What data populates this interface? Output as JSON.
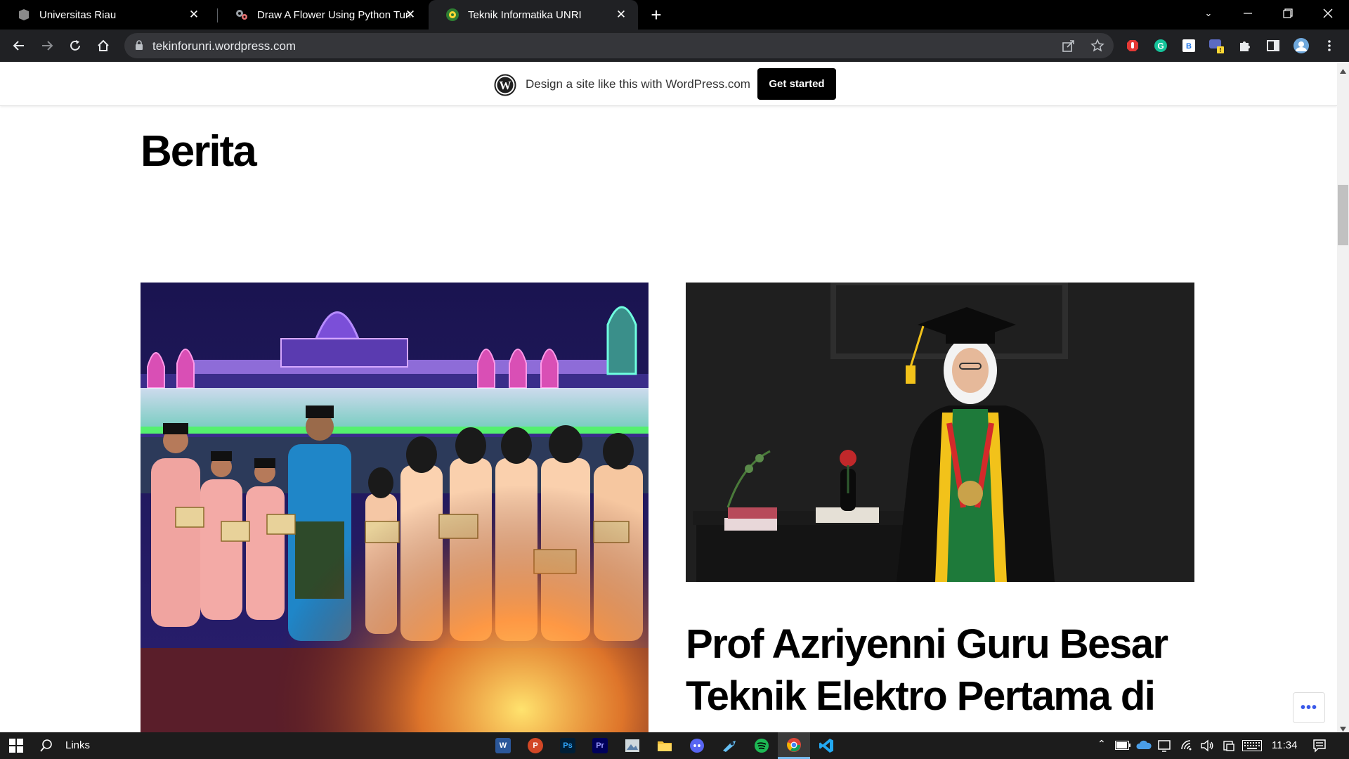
{
  "browser": {
    "tabs": [
      {
        "title": "Universitas Riau",
        "favicon": "shield-icon",
        "active": false
      },
      {
        "title": "Draw A Flower Using Python Turtle",
        "favicon": "gears-icon",
        "active": false
      },
      {
        "title": "Teknik Informatika UNRI",
        "favicon": "unri-logo-icon",
        "active": true
      }
    ],
    "new_tab_label": "+",
    "url": "tekinforunri.wordpress.com"
  },
  "wp_banner": {
    "text": "Design a site like this with WordPress.com",
    "cta": "Get started"
  },
  "page": {
    "title": "Berita",
    "post_title": "Prof Azriyenni Guru Besar Teknik Elektro Pertama di",
    "more_button": "•••"
  },
  "taskbar": {
    "search_label": "Links",
    "clock": "11:34",
    "apps": [
      {
        "name": "word",
        "label": "W",
        "color": "#2b579a"
      },
      {
        "name": "powerpoint",
        "label": "P",
        "color": "#d24726"
      },
      {
        "name": "photoshop",
        "label": "Ps",
        "color": "#001e36"
      },
      {
        "name": "premiere",
        "label": "Pr",
        "color": "#00005b"
      },
      {
        "name": "photos",
        "label": "",
        "color": "#5a7fa8"
      },
      {
        "name": "file-explorer",
        "label": "",
        "color": "#f3c13a"
      },
      {
        "name": "discord",
        "label": "",
        "color": "#5865f2"
      },
      {
        "name": "steam",
        "label": "",
        "color": "#1b2838"
      },
      {
        "name": "spotify",
        "label": "",
        "color": "#1db954"
      },
      {
        "name": "chrome",
        "label": "",
        "color": "#4285f4"
      },
      {
        "name": "vscode",
        "label": "",
        "color": "#0078d4"
      }
    ]
  },
  "colors": {
    "tabstrip": "#000000",
    "toolbar": "#202124",
    "cta_bg": "#000000",
    "taskbar": "#1c1c1c"
  }
}
